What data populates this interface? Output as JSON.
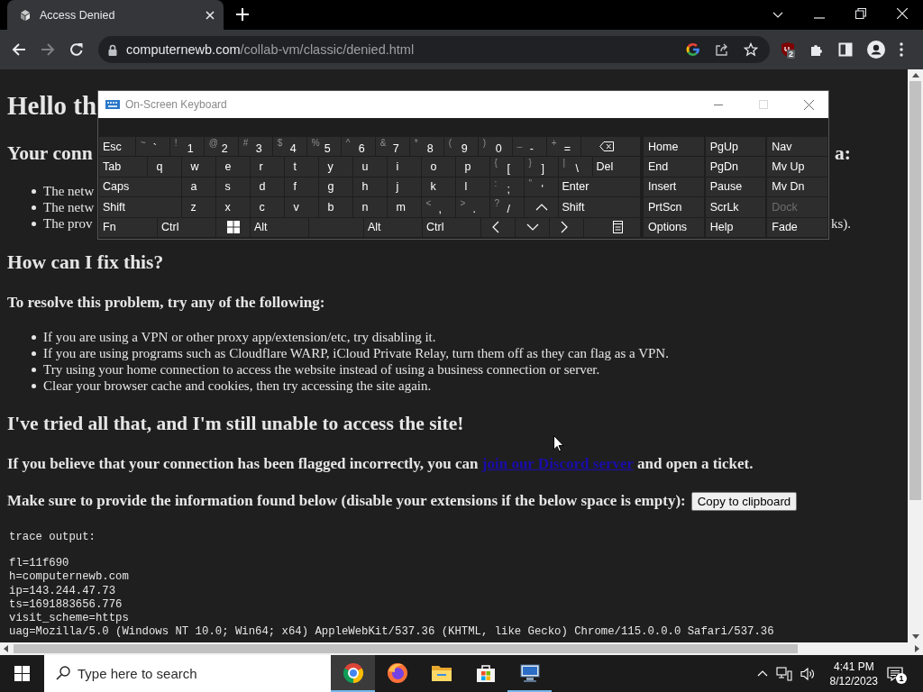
{
  "browser": {
    "tab_title": "Access Denied",
    "url_host": "computernewb.com",
    "url_path": "/collab-vm/classic/denied.html",
    "extension_badge": "2"
  },
  "page": {
    "title": "Hello th",
    "intro_heading": {
      "left": "Your conn",
      "right": "a:"
    },
    "intro_bullets": [
      {
        "left": "The netw"
      },
      {
        "left": "The netw"
      },
      {
        "left": "The prov",
        "right": "ks)."
      }
    ],
    "fix_heading": "How can I fix this?",
    "fix_intro": "To resolve this problem, try any of the following:",
    "fix_steps": [
      "If you are using a VPN or other proxy app/extension/etc, try disabling it.",
      "If you are using programs such as Cloudflare WARP, iCloud Private Relay, turn them off as they can flag as a VPN.",
      "Try using your home connection to access the website instead of using a business connection or server.",
      "Clear your browser cache and cookies, then try accessing the site again."
    ],
    "tried_heading": "I've tried all that, and I'm still unable to access the site!",
    "discord": {
      "before": "If you believe that your connection has been flagged incorrectly, you can",
      "link": "join our Discord server",
      "after": "and open a ticket."
    },
    "provide": {
      "text": "Make sure to provide the information found below (disable your extensions if the below space is empty):",
      "button": "Copy to clipboard"
    },
    "trace": {
      "label": "trace output:",
      "lines": [
        "fl=11f690",
        "h=computernewb.com",
        "ip=143.244.47.73",
        "ts=1691883656.776",
        "visit_scheme=https",
        "uag=Mozilla/5.0 (Windows NT 10.0; Win64; x64) AppleWebKit/537.36 (KHTML, like Gecko) Chrome/115.0.0.0 Safari/537.36"
      ]
    }
  },
  "keyboard": {
    "title": "On-Screen Keyboard",
    "rows": [
      [
        {
          "kind": "text",
          "label": "Esc"
        },
        {
          "kind": "dual",
          "shift": "~",
          "label": "`"
        },
        {
          "kind": "dual",
          "shift": "!",
          "label": "1"
        },
        {
          "kind": "dual",
          "shift": "@",
          "label": "2"
        },
        {
          "kind": "dual",
          "shift": "#",
          "label": "3"
        },
        {
          "kind": "dual",
          "shift": "$",
          "label": "4"
        },
        {
          "kind": "dual",
          "shift": "%",
          "label": "5"
        },
        {
          "kind": "dual",
          "shift": "^",
          "label": "6"
        },
        {
          "kind": "dual",
          "shift": "&",
          "label": "7"
        },
        {
          "kind": "dual",
          "shift": "*",
          "label": "8"
        },
        {
          "kind": "dual",
          "shift": "(",
          "label": "9"
        },
        {
          "kind": "dual",
          "shift": ")",
          "label": "0"
        },
        {
          "kind": "dual",
          "shift": "_",
          "label": "-"
        },
        {
          "kind": "dual",
          "shift": "+",
          "label": "="
        },
        {
          "kind": "backspace"
        }
      ],
      [
        {
          "kind": "text",
          "label": "Tab"
        },
        {
          "kind": "char",
          "label": "q"
        },
        {
          "kind": "char",
          "label": "w"
        },
        {
          "kind": "char",
          "label": "e"
        },
        {
          "kind": "char",
          "label": "r"
        },
        {
          "kind": "char",
          "label": "t"
        },
        {
          "kind": "char",
          "label": "y"
        },
        {
          "kind": "char",
          "label": "u"
        },
        {
          "kind": "char",
          "label": "i"
        },
        {
          "kind": "char",
          "label": "o"
        },
        {
          "kind": "char",
          "label": "p"
        },
        {
          "kind": "dual",
          "shift": "{",
          "label": "["
        },
        {
          "kind": "dual",
          "shift": "}",
          "label": "]"
        },
        {
          "kind": "dual",
          "shift": "|",
          "label": "\\"
        },
        {
          "kind": "text",
          "label": "Del"
        }
      ],
      [
        {
          "kind": "text",
          "label": "Caps"
        },
        {
          "kind": "char",
          "label": "a"
        },
        {
          "kind": "char",
          "label": "s"
        },
        {
          "kind": "char",
          "label": "d"
        },
        {
          "kind": "char",
          "label": "f"
        },
        {
          "kind": "char",
          "label": "g"
        },
        {
          "kind": "char",
          "label": "h"
        },
        {
          "kind": "char",
          "label": "j"
        },
        {
          "kind": "char",
          "label": "k"
        },
        {
          "kind": "char",
          "label": "l"
        },
        {
          "kind": "dual",
          "shift": ":",
          "label": ";"
        },
        {
          "kind": "dual",
          "shift": "\"",
          "label": "'"
        },
        {
          "kind": "text",
          "label": "Enter"
        }
      ],
      [
        {
          "kind": "text",
          "label": "Shift"
        },
        {
          "kind": "char",
          "label": "z"
        },
        {
          "kind": "char",
          "label": "x"
        },
        {
          "kind": "char",
          "label": "c"
        },
        {
          "kind": "char",
          "label": "v"
        },
        {
          "kind": "char",
          "label": "b"
        },
        {
          "kind": "char",
          "label": "n"
        },
        {
          "kind": "char",
          "label": "m"
        },
        {
          "kind": "dual",
          "shift": "<",
          "label": ","
        },
        {
          "kind": "dual",
          "shift": ">",
          "label": "."
        },
        {
          "kind": "dual",
          "shift": "?",
          "label": "/"
        },
        {
          "kind": "up"
        },
        {
          "kind": "text",
          "label": "Shift"
        }
      ],
      [
        {
          "kind": "text",
          "label": "Fn"
        },
        {
          "kind": "text",
          "label": "Ctrl"
        },
        {
          "kind": "windows"
        },
        {
          "kind": "text",
          "label": "Alt"
        },
        {
          "kind": "space"
        },
        {
          "kind": "text",
          "label": "Alt"
        },
        {
          "kind": "text",
          "label": "Ctrl"
        },
        {
          "kind": "left"
        },
        {
          "kind": "down"
        },
        {
          "kind": "right"
        },
        {
          "kind": "menu"
        }
      ]
    ],
    "nav": [
      [
        {
          "label": "Home",
          "disabled": false
        },
        {
          "label": "PgUp",
          "disabled": false
        },
        {
          "label": "Nav",
          "disabled": false
        }
      ],
      [
        {
          "label": "End",
          "disabled": false
        },
        {
          "label": "PgDn",
          "disabled": false
        },
        {
          "label": "Mv Up",
          "disabled": false
        }
      ],
      [
        {
          "label": "Insert",
          "disabled": false
        },
        {
          "label": "Pause",
          "disabled": false
        },
        {
          "label": "Mv Dn",
          "disabled": false
        }
      ],
      [
        {
          "label": "PrtScn",
          "disabled": false
        },
        {
          "label": "ScrLk",
          "disabled": false
        },
        {
          "label": "Dock",
          "disabled": true
        }
      ],
      [
        {
          "label": "Options",
          "disabled": false
        },
        {
          "label": "Help",
          "disabled": false
        },
        {
          "label": "Fade",
          "disabled": false
        }
      ]
    ]
  },
  "taskbar": {
    "search_placeholder": "Type here to search",
    "apps": [
      {
        "kind": "chrome",
        "selected": true,
        "running": true
      },
      {
        "kind": "firefox",
        "selected": false,
        "running": false
      },
      {
        "kind": "explorer",
        "selected": false,
        "running": false
      },
      {
        "kind": "store",
        "selected": false,
        "running": false
      },
      {
        "kind": "remote",
        "selected": false,
        "running": true
      }
    ],
    "time": "4:41 PM",
    "date": "8/12/2023",
    "notification_count": "1"
  }
}
